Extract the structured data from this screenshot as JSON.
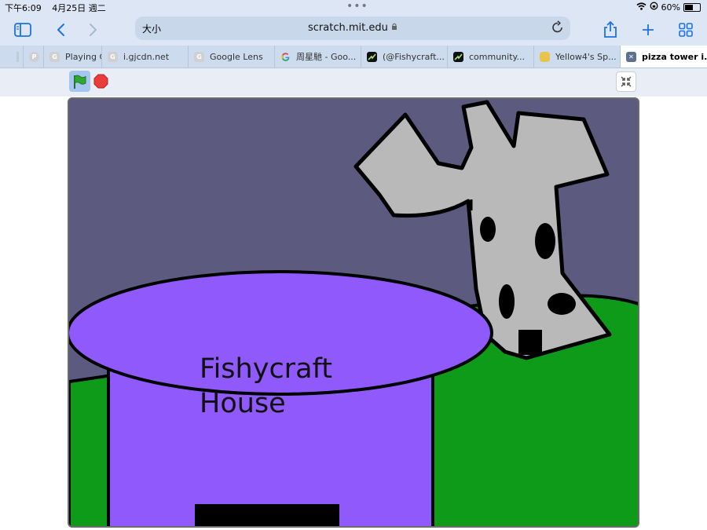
{
  "status": {
    "time": "下午6:09",
    "date": "4月25日 週二",
    "battery": "60%",
    "battery_level": 0.6
  },
  "toolbar": {
    "text_size": "大小",
    "url": "scratch.mit.edu"
  },
  "tabs": [
    {
      "label": "",
      "favicon": "tab-icon"
    },
    {
      "label": "",
      "favicon": "P"
    },
    {
      "label": "Playing C",
      "favicon": "G"
    },
    {
      "label": "i.gjcdn.net",
      "favicon": "G"
    },
    {
      "label": "Google Lens",
      "favicon": "G"
    },
    {
      "label": "周星馳 - Goo...",
      "favicon": "google-icon"
    },
    {
      "label": "(@Fishycraft...",
      "favicon": "dark-icon"
    },
    {
      "label": "community...",
      "favicon": "dark-icon"
    },
    {
      "label": "Yellow4's Sp...",
      "favicon": "gold-icon"
    },
    {
      "label": "pizza tower i...",
      "favicon": "close-icon"
    }
  ],
  "stage": {
    "house_label": "Fishycraft House",
    "colors": {
      "sky": "#5c5a7e",
      "grass": "#0f9b1a",
      "house": "#8f59fb",
      "tower": "#b9b9b9",
      "outline": "#000000"
    }
  }
}
